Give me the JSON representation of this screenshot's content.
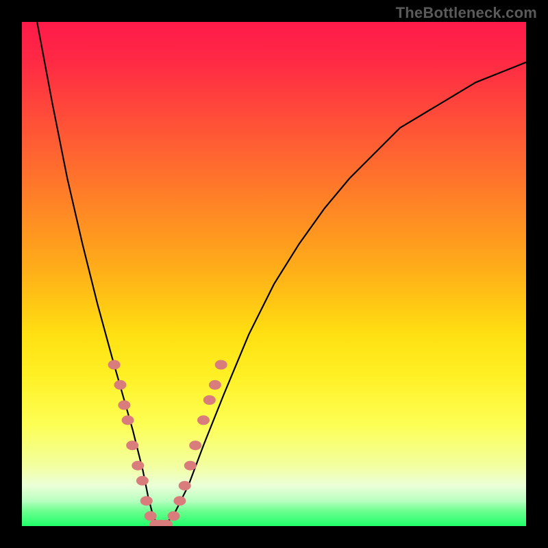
{
  "watermark": "TheBottleneck.com",
  "chart_data": {
    "type": "line",
    "title": "",
    "xlabel": "",
    "ylabel": "",
    "xlim": [
      0,
      100
    ],
    "ylim": [
      0,
      100
    ],
    "series": [
      {
        "name": "bottleneck-curve",
        "x": [
          3,
          6,
          9,
          12,
          15,
          18,
          20,
          22,
          24,
          25,
          26,
          27,
          28,
          30,
          33,
          36,
          40,
          45,
          50,
          55,
          60,
          65,
          70,
          75,
          80,
          85,
          90,
          95,
          100
        ],
        "y": [
          100,
          84,
          69,
          56,
          44,
          33,
          26,
          19,
          11,
          6,
          2,
          0,
          0,
          2,
          8,
          16,
          26,
          38,
          48,
          56,
          63,
          69,
          74,
          79,
          82,
          85,
          88,
          90,
          92
        ]
      }
    ],
    "markers": {
      "name": "highlighted-points",
      "color": "#d97c7c",
      "points": [
        {
          "x": 18.3,
          "y": 32
        },
        {
          "x": 19.5,
          "y": 28
        },
        {
          "x": 20.3,
          "y": 24
        },
        {
          "x": 21.0,
          "y": 21
        },
        {
          "x": 21.9,
          "y": 16
        },
        {
          "x": 23.0,
          "y": 12
        },
        {
          "x": 23.9,
          "y": 9
        },
        {
          "x": 24.7,
          "y": 5
        },
        {
          "x": 25.5,
          "y": 2
        },
        {
          "x": 26.5,
          "y": 0.3
        },
        {
          "x": 27.6,
          "y": 0.3
        },
        {
          "x": 28.7,
          "y": 0.3
        },
        {
          "x": 30.1,
          "y": 2
        },
        {
          "x": 31.3,
          "y": 5
        },
        {
          "x": 32.3,
          "y": 8
        },
        {
          "x": 33.4,
          "y": 12
        },
        {
          "x": 34.4,
          "y": 16
        },
        {
          "x": 36.0,
          "y": 21
        },
        {
          "x": 37.2,
          "y": 25
        },
        {
          "x": 38.3,
          "y": 28
        },
        {
          "x": 39.5,
          "y": 32
        }
      ]
    },
    "gradient_stops": [
      {
        "pos": 0,
        "color": "#ff1a4a"
      },
      {
        "pos": 50,
        "color": "#ffd015"
      },
      {
        "pos": 80,
        "color": "#fdff55"
      },
      {
        "pos": 100,
        "color": "#20ff6a"
      }
    ]
  }
}
